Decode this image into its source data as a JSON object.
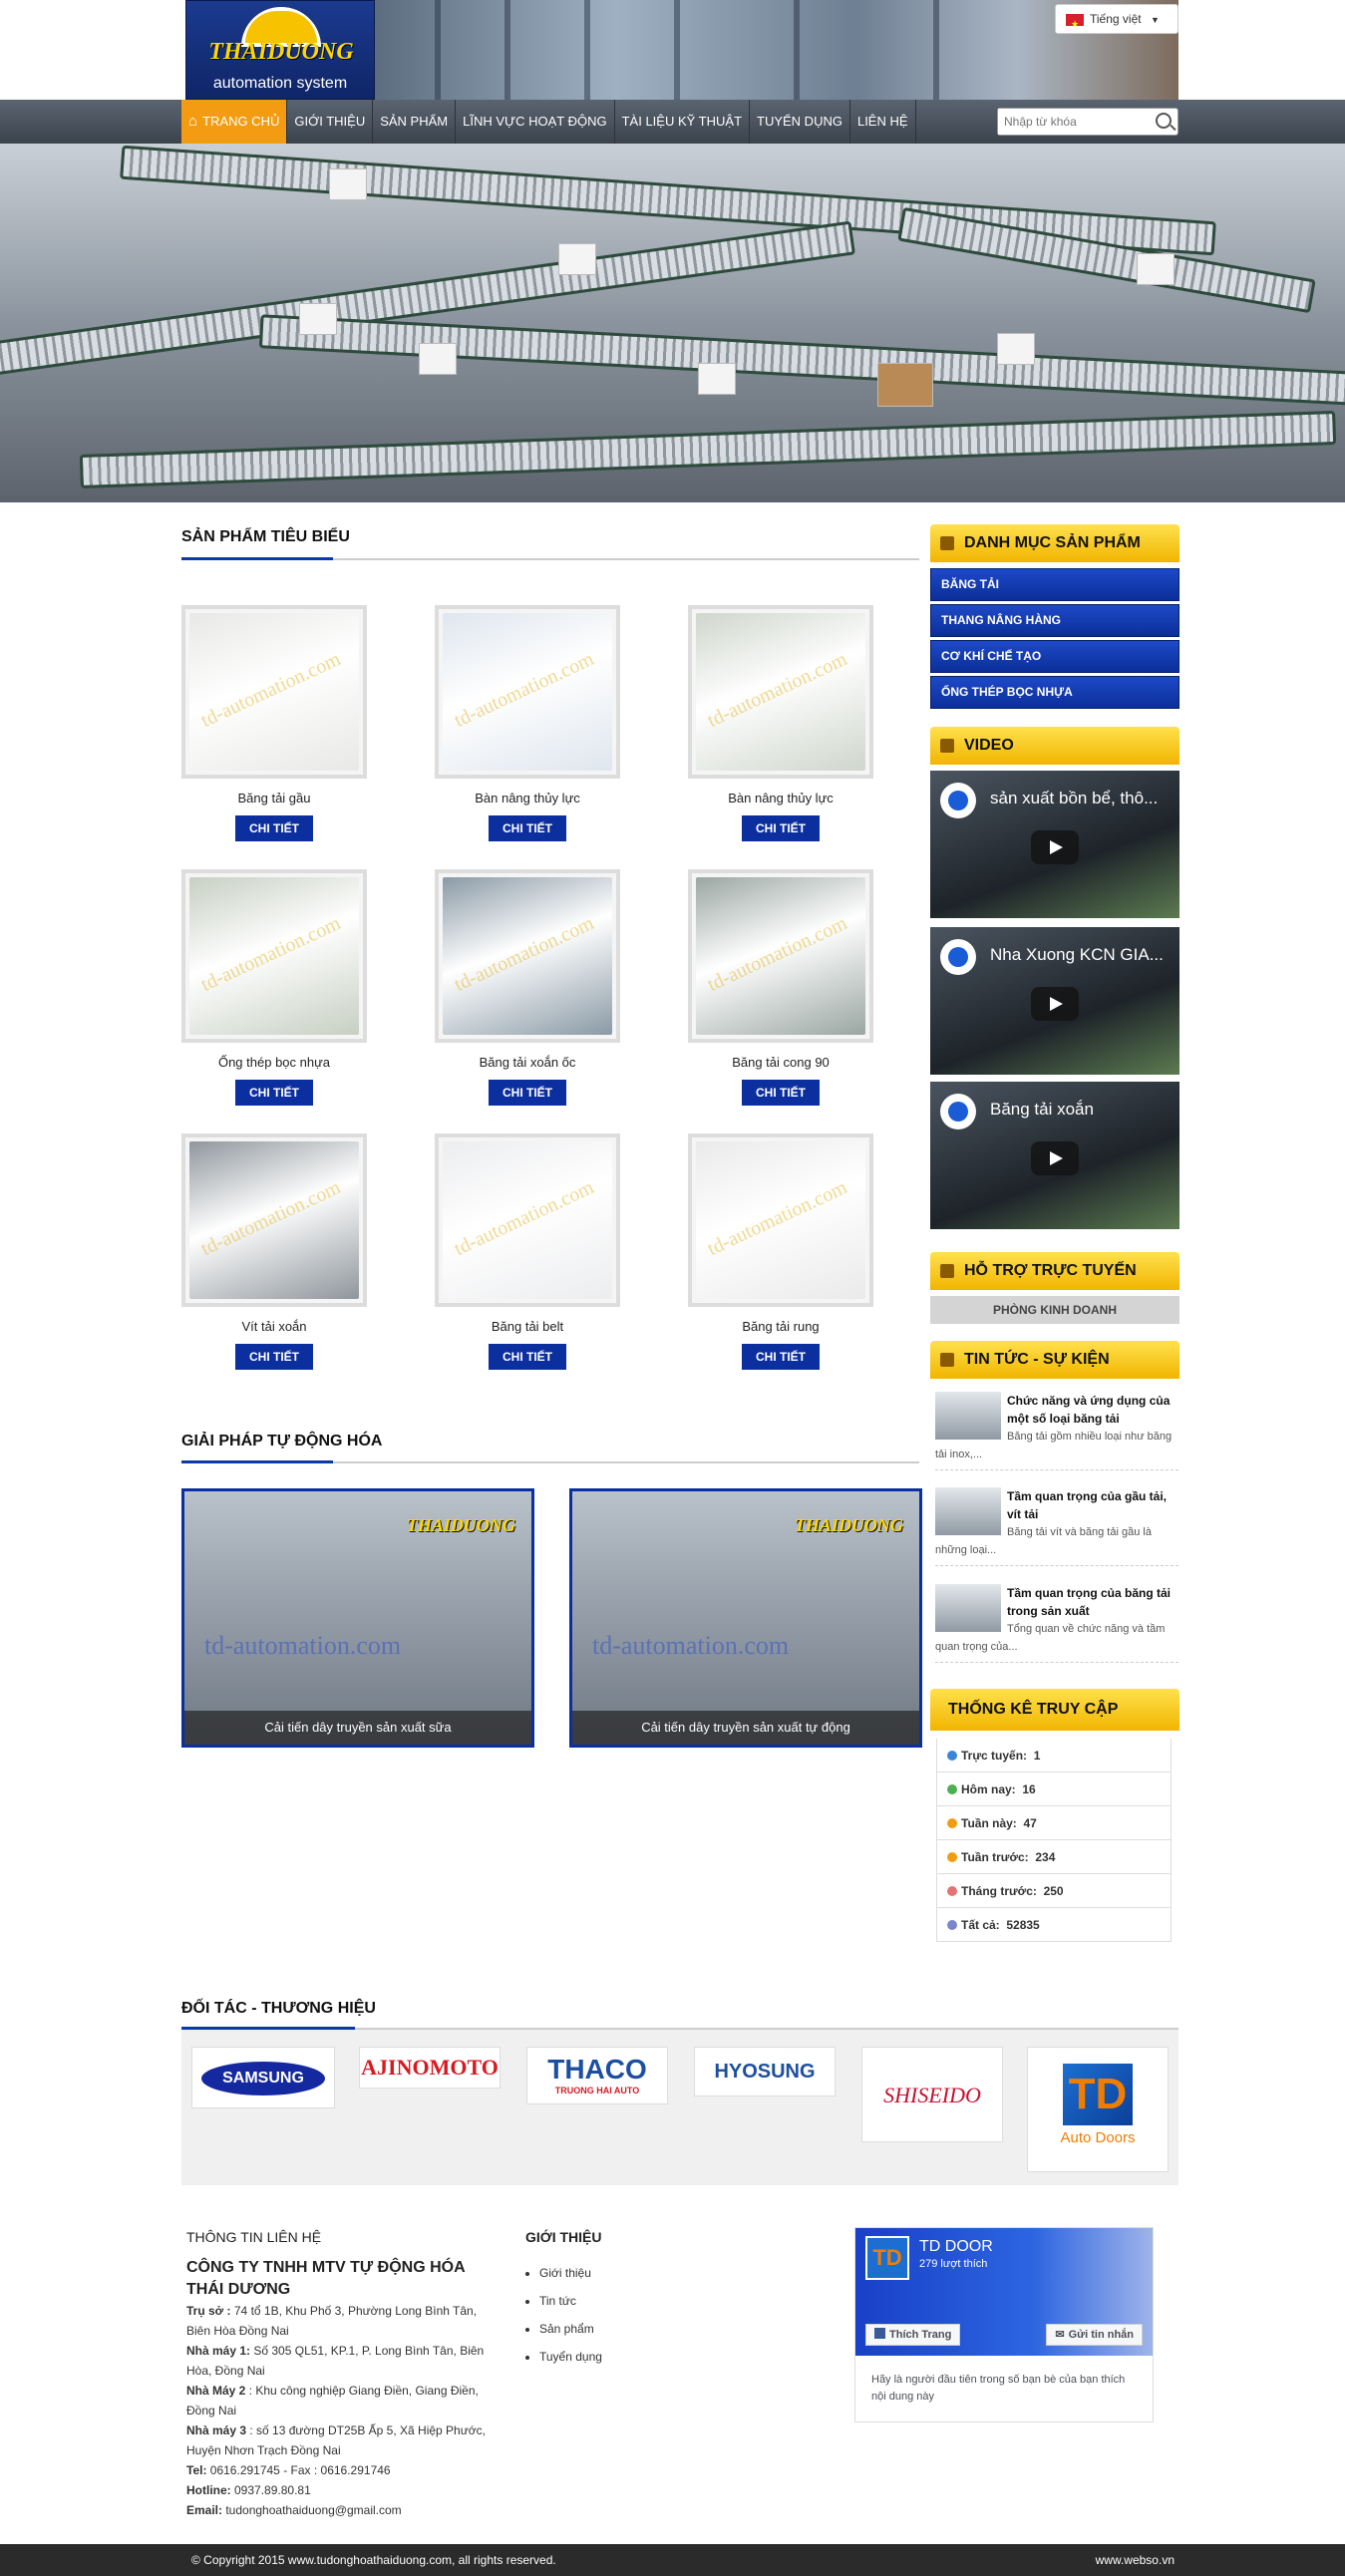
{
  "header": {
    "logo_brand": "THAIDUONG",
    "logo_tagline": "automation system",
    "language": "Tiếng việt"
  },
  "nav": {
    "items": [
      "TRANG CHỦ",
      "GIỚI THIỆU",
      "SẢN PHẨM",
      "LĨNH VỰC HOẠT ĐỘNG",
      "TÀI LIỆU KỸ THUẬT",
      "TUYỂN DỤNG",
      "LIÊN HỆ"
    ],
    "search_placeholder": "Nhập từ khóa"
  },
  "featured": {
    "title": "SẢN PHẨM TIÊU BIỂU",
    "button_label": "CHI TIẾT",
    "watermark": "td-automation.com",
    "products": [
      {
        "name": "Băng tải gầu",
        "color": "#e8e8e6"
      },
      {
        "name": "Bàn nâng thủy lực",
        "color": "#dfe6ee"
      },
      {
        "name": "Bàn nâng thủy lực",
        "color": "#cfd6cc"
      },
      {
        "name": "Ống thép bọc nhựa",
        "color": "#c7cfc2"
      },
      {
        "name": "Băng tải xoắn ốc",
        "color": "#8a9aa6"
      },
      {
        "name": "Băng tải cong 90",
        "color": "#9aa6a2"
      },
      {
        "name": "Vít tải xoắn",
        "color": "#8f969c"
      },
      {
        "name": "Băng tải belt",
        "color": "#ecedef"
      },
      {
        "name": "Băng tải rung",
        "color": "#eaeaea"
      }
    ]
  },
  "solutions": {
    "title": "GIẢI PHÁP TỰ ĐỘNG HÓA",
    "items": [
      {
        "caption": "Cải tiến dây truyền sản xuất sữa"
      },
      {
        "caption": "Cải tiến dây truyền sản xuất tự động"
      }
    ]
  },
  "sidebar": {
    "categories_title": "DANH MỤC SẢN PHẨM",
    "categories": [
      "BĂNG TẢI",
      "THANG NÂNG HÀNG",
      "CƠ KHÍ CHẾ TẠO",
      "ỐNG THÉP BỌC NHỰA"
    ],
    "video_title": "VIDEO",
    "videos": [
      "sản xuất bồn bể, thô...",
      "Nha Xuong KCN GIA...",
      "Băng tải xoắn"
    ],
    "support_title": "HỖ TRỢ TRỰC TUYẾN",
    "support_dept": "PHÒNG KINH DOANH",
    "news_title": "TIN TỨC - SỰ KIỆN",
    "news": [
      {
        "title": "Chức năng và ứng dụng của một số loại băng tải",
        "excerpt": "Băng tải gồm nhiều loại như băng tải inox,..."
      },
      {
        "title": "Tầm quan trọng của gầu tải, vít tải",
        "excerpt": "Băng tải vít và băng tải gầu là những loại..."
      },
      {
        "title": "Tầm quan trọng của băng tải trong sản xuất",
        "excerpt": "Tổng quan về chức năng và tầm quan trọng của..."
      }
    ],
    "stats_title": "THỐNG KÊ TRUY CẬP",
    "stats": [
      {
        "label": "Trực tuyến:",
        "value": "1",
        "color": "#3a86d6"
      },
      {
        "label": "Hôm nay:",
        "value": "16",
        "color": "#4caf50"
      },
      {
        "label": "Tuần này:",
        "value": "47",
        "color": "#f39c12"
      },
      {
        "label": "Tuần trước:",
        "value": "234",
        "color": "#f39c12"
      },
      {
        "label": "Tháng trước:",
        "value": "250",
        "color": "#e57373"
      },
      {
        "label": "Tất cả:",
        "value": "52835",
        "color": "#7986cb"
      }
    ]
  },
  "partners": {
    "title": "ĐỐI TÁC - THƯƠNG HIỆU",
    "items": [
      {
        "name": "SAMSUNG",
        "color": "#1428a0"
      },
      {
        "name": "AJINOMOTO",
        "color": "#d71920"
      },
      {
        "name": "THACO",
        "sub": "TRUONG HAI AUTO",
        "color": "#1c4fa0"
      },
      {
        "name": "HYOSUNG",
        "color": "#1c4fa0"
      },
      {
        "name": "SHISEIDO",
        "color": "#c8102e"
      },
      {
        "name": "TD",
        "sub": "Auto Doors",
        "color": "#f07d00"
      }
    ]
  },
  "footer": {
    "contact_title": "THÔNG TIN LIÊN HỆ",
    "company": "CÔNG TY TNHH MTV TỰ ĐỘNG HÓA THÁI DƯƠNG",
    "lines": [
      {
        "label": "Trụ sở :",
        "text": " 74 tổ 1B, Khu Phố 3, Phường Long Bình Tân, Biên Hòa Đồng Nai"
      },
      {
        "label": "Nhà máy 1:",
        "text": " Số 305 QL51, KP.1, P. Long Bình Tân, Biên Hòa, Đồng Nai"
      },
      {
        "label": "Nhà Máy 2",
        "text": " : Khu công nghiệp Giang Điền, Giang Điền, Đồng Nai"
      },
      {
        "label": "Nhà máy 3",
        "text": " : số 13 đường DT25B  Ấp 5, Xã Hiệp Phước, Huyện Nhơn Trạch Đồng Nai"
      },
      {
        "label": "Tel:",
        "text": " 0616.291745 - Fax : 0616.291746"
      },
      {
        "label": "Hotline:",
        "text": " 0937.89.80.81"
      },
      {
        "label": "Email:",
        "text": " tudonghoathaiduong@gmail.com"
      }
    ],
    "intro_title": "GIỚI THIỆU",
    "intro_links": [
      "Giới thiệu",
      "Tin tức",
      "Sản phẩm",
      "Tuyển dụng"
    ],
    "fb": {
      "page": "TD DOOR",
      "likes": "279 lượt thích",
      "like_btn": "Thích Trang",
      "msg_btn": "Gửi tin nhắn",
      "note": "Hãy là người đầu tiên trong số bạn bè của bạn thích nội dung này"
    },
    "copyright": "© Copyright 2015 www.tudonghoathaiduong.com, all rights reserved.",
    "credit": "www.webso.vn"
  }
}
